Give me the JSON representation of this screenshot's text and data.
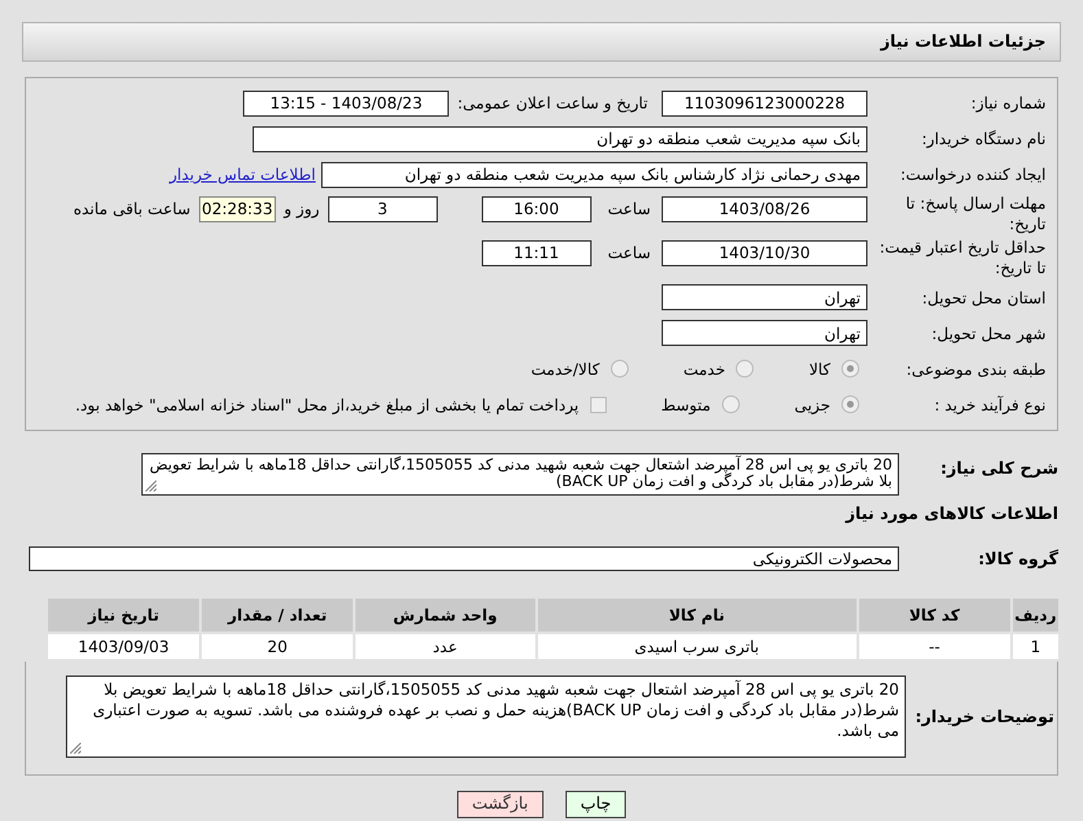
{
  "header": {
    "title": "جزئیات اطلاعات نیاز"
  },
  "need_number": {
    "label": "شماره نیاز:",
    "value": "1103096123000228"
  },
  "announce": {
    "label": "تاریخ و ساعت اعلان عمومی:",
    "value": "1403/08/23 - 13:15"
  },
  "buyer_org": {
    "label": "نام دستگاه خریدار:",
    "value": "بانک سپه مدیریت شعب منطقه دو تهران"
  },
  "requester": {
    "label": "ایجاد کننده درخواست:",
    "value": "مهدی رحمانی نژاد کارشناس بانک سپه مدیریت شعب منطقه دو تهران",
    "link": "اطلاعات تماس خریدار"
  },
  "deadline": {
    "label": "مهلت ارسال پاسخ: تا تاریخ:",
    "date": "1403/08/26",
    "time_label": "ساعت",
    "time": "16:00",
    "days": "3",
    "days_label": "روز و",
    "remaining": "02:28:33",
    "remaining_label": "ساعت باقی مانده"
  },
  "validity": {
    "label": "حداقل تاریخ اعتبار قیمت: تا تاریخ:",
    "date": "1403/10/30",
    "time_label": "ساعت",
    "time": "11:11"
  },
  "province": {
    "label": "استان محل تحویل:",
    "value": "تهران"
  },
  "city": {
    "label": "شهر محل تحویل:",
    "value": "تهران"
  },
  "category": {
    "label": "طبقه بندی موضوعی:",
    "options": [
      {
        "label": "کالا",
        "selected": true
      },
      {
        "label": "خدمت",
        "selected": false
      },
      {
        "label": "کالا/خدمت",
        "selected": false
      }
    ]
  },
  "process": {
    "label": "نوع فرآیند خرید :",
    "options": [
      {
        "label": "جزیی",
        "selected": true
      },
      {
        "label": "متوسط",
        "selected": false
      }
    ],
    "checkbox": {
      "label": "پرداخت تمام یا بخشی از مبلغ خرید،از محل \"اسناد خزانه اسلامی\" خواهد بود.",
      "checked": false
    }
  },
  "summary": {
    "label": "شرح کلی نیاز:",
    "value": "20 باتری یو پی اس 28 آمپرضد اشتعال جهت شعبه شهید مدنی کد 1505055،گارانتی حداقل 18ماهه با شرایط تعویض بلا شرط(در مقابل باد کردگی و افت زمان BACK UP)"
  },
  "goods_title": "اطلاعات کالاهای مورد نیاز",
  "goods_group": {
    "label": "گروه کالا:",
    "value": "محصولات الکترونیکی"
  },
  "table": {
    "columns": [
      "ردیف",
      "کد کالا",
      "نام کالا",
      "واحد شمارش",
      "تعداد / مقدار",
      "تاریخ نیاز"
    ],
    "rows": [
      [
        "1",
        "--",
        "باتری سرب اسیدی",
        "عدد",
        "20",
        "1403/09/03"
      ]
    ]
  },
  "buyer_notes": {
    "label": "توضیحات خریدار:",
    "value": "20 باتری یو پی اس 28 آمپرضد اشتعال جهت شعبه شهید مدنی کد 1505055،گارانتی حداقل 18ماهه با شرایط تعویض بلا شرط(در مقابل باد کردگی و افت زمان BACK UP)هزینه حمل و نصب بر عهده فروشنده می باشد. تسویه به صورت اعتباری می باشد."
  },
  "buttons": [
    {
      "label": "چاپ",
      "kind": "print"
    },
    {
      "label": "بازگشت",
      "kind": "back"
    }
  ]
}
